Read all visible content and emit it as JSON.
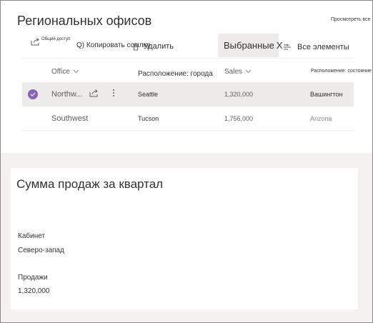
{
  "list": {
    "title": "Региональных офисов",
    "view_all": "Просмотреть все",
    "commands": {
      "share_label": "Общий доступ",
      "copy_link_label": "Q) Копировать ссылку",
      "delete_label": "Удалить"
    },
    "selected": {
      "label": "Выбранные",
      "clear": "X"
    },
    "view_label": "Все элементы",
    "columns": {
      "office": "Office",
      "location": "Расположение: города",
      "sales": "Sales",
      "state": "Расположение: состояние"
    },
    "rows": [
      {
        "office": "Northw...",
        "location": "Seattle",
        "sales": "1,320,000",
        "state": "Вашингтон",
        "selected": true
      },
      {
        "office": "Southwest",
        "location": "Tucson",
        "sales": "1,756,000",
        "state": "Arizona",
        "selected": false
      }
    ]
  },
  "card": {
    "title": "Сумма продаж за квартал",
    "office_label": "Кабинет",
    "office_value": "Северо-запад",
    "sales_label": "Продажи",
    "sales_value": "1,320,000"
  },
  "colors": {
    "accent": "#8764b8",
    "selected_row": "#edebe9",
    "page_bg": "#f3f2f1"
  },
  "icons": [
    "share-icon",
    "link-icon",
    "trash-icon",
    "filter-icon",
    "chevron-down-icon",
    "checkmark-icon",
    "more-icon"
  ]
}
